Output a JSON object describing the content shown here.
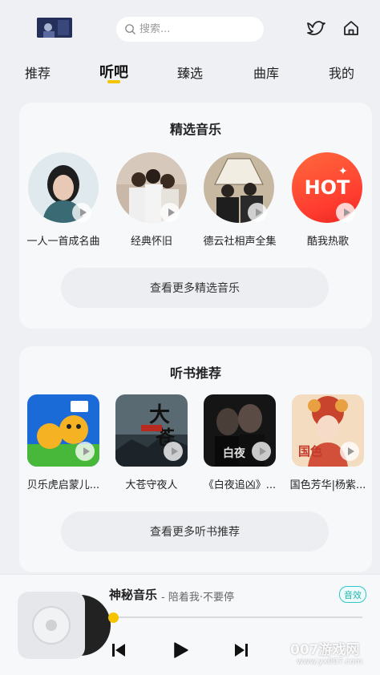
{
  "header": {
    "search_placeholder": "搜索..."
  },
  "tabs": [
    {
      "label": "推荐",
      "active": false
    },
    {
      "label": "听吧",
      "active": true
    },
    {
      "label": "臻选",
      "active": false
    },
    {
      "label": "曲库",
      "active": false
    },
    {
      "label": "我的",
      "active": false
    }
  ],
  "featured_music": {
    "title": "精选音乐",
    "items": [
      {
        "label": "一人一首成名曲"
      },
      {
        "label": "经典怀旧"
      },
      {
        "label": "德云社相声全集"
      },
      {
        "label": "酷我热歌"
      }
    ],
    "hot_badge": "HOT",
    "more_label": "查看更多精选音乐"
  },
  "audiobooks": {
    "title": "听书推荐",
    "items": [
      {
        "label": "贝乐虎启蒙儿..."
      },
      {
        "label": "大苍守夜人"
      },
      {
        "label": "《白夜追凶》..."
      },
      {
        "label": "国色芳华|杨紫..."
      }
    ],
    "more_label": "查看更多听书推荐"
  },
  "player": {
    "song_title": "神秘音乐",
    "song_subtitle": "- 陪着我·不要停",
    "sfx_label": "音效",
    "progress": 0.0
  },
  "watermark": {
    "brand": "007游戏网",
    "url": "www.yx007.com"
  },
  "colors": {
    "accent": "#f5c400",
    "sfx": "#1fb5b5",
    "background": "#eef0f4"
  }
}
